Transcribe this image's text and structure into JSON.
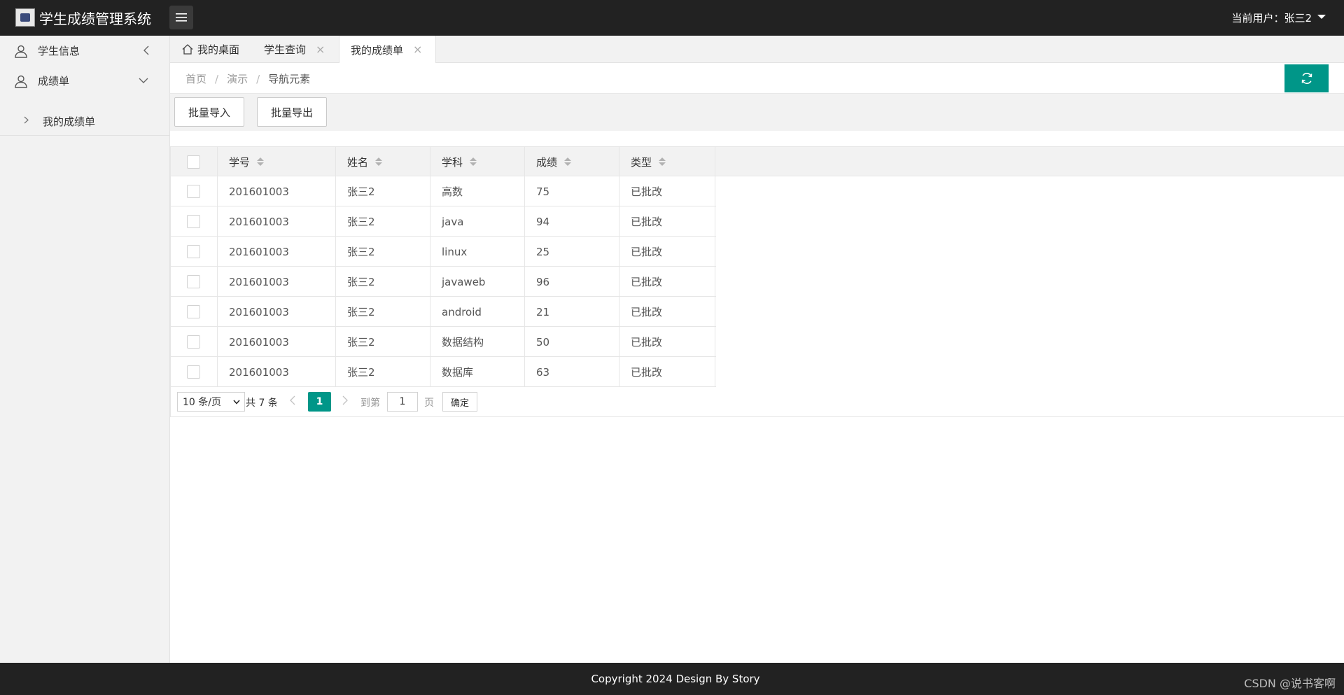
{
  "header": {
    "app_title": "学生成绩管理系统",
    "current_user_label": "当前用户：张三2"
  },
  "sidebar": {
    "items": [
      {
        "label": "学生信息",
        "icon": "user-icon",
        "expanded": false
      },
      {
        "label": "成绩单",
        "icon": "user-icon",
        "expanded": true,
        "children": [
          {
            "label": "我的成绩单"
          }
        ]
      }
    ]
  },
  "tabs": [
    {
      "label": "我的桌面",
      "icon": "home-icon",
      "closable": false,
      "active": false
    },
    {
      "label": "学生查询",
      "closable": true,
      "active": false
    },
    {
      "label": "我的成绩单",
      "closable": true,
      "active": true
    }
  ],
  "tab_close_glyph": "×",
  "breadcrumb": {
    "items": [
      "首页",
      "演示",
      "导航元素"
    ],
    "separator": "/"
  },
  "toolbar": {
    "import_label": "批量导入",
    "export_label": "批量导出"
  },
  "table": {
    "columns": [
      "学号",
      "姓名",
      "学科",
      "成绩",
      "类型"
    ],
    "rows": [
      [
        "201601003",
        "张三2",
        "高数",
        "75",
        "已批改"
      ],
      [
        "201601003",
        "张三2",
        "java",
        "94",
        "已批改"
      ],
      [
        "201601003",
        "张三2",
        "linux",
        "25",
        "已批改"
      ],
      [
        "201601003",
        "张三2",
        "javaweb",
        "96",
        "已批改"
      ],
      [
        "201601003",
        "张三2",
        "android",
        "21",
        "已批改"
      ],
      [
        "201601003",
        "张三2",
        "数据结构",
        "50",
        "已批改"
      ],
      [
        "201601003",
        "张三2",
        "数据库",
        "63",
        "已批改"
      ]
    ]
  },
  "pagination": {
    "page_size_label": "10 条/页",
    "total_label": "共 7 条",
    "current_page": "1",
    "goto_label": "到第",
    "goto_value": "1",
    "page_suffix": "页",
    "confirm_label": "确定"
  },
  "footer": {
    "copyright": "Copyright 2024 Design By Story",
    "watermark": "CSDN @说书客啊"
  },
  "colors": {
    "accent": "#009688",
    "header_bg": "#222222",
    "sidebar_bg": "#f2f2f2"
  }
}
